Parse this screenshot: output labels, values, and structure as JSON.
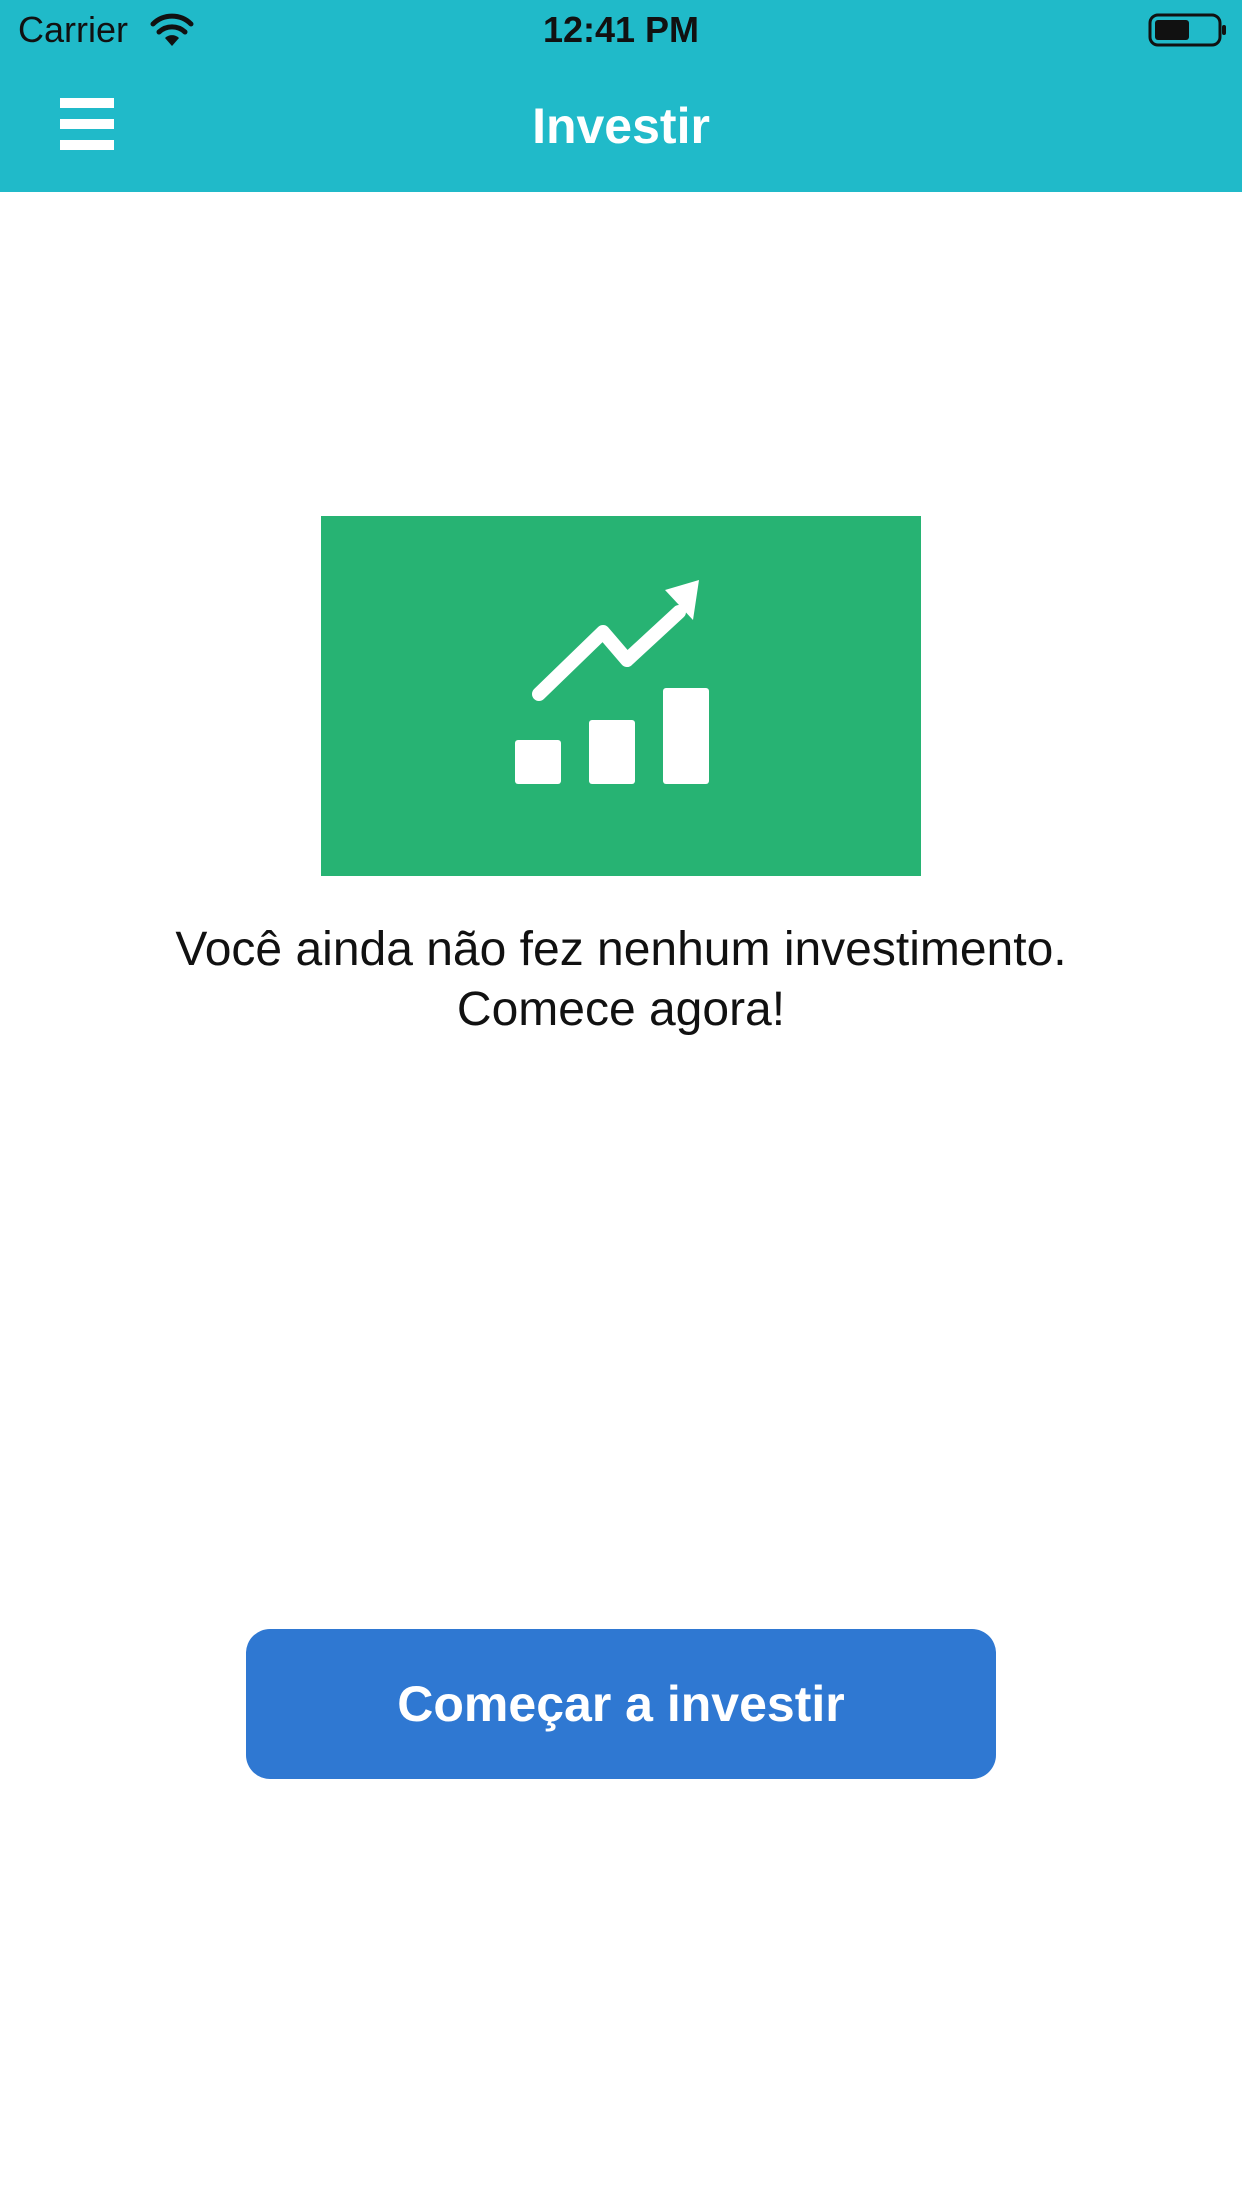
{
  "status_bar": {
    "carrier": "Carrier",
    "time": "12:41 PM",
    "wifi_icon": "wifi-icon",
    "battery_icon": "battery-icon"
  },
  "nav_bar": {
    "title": "Investir",
    "menu_icon": "hamburger-menu-icon"
  },
  "empty_state": {
    "illustration_icon": "growth-chart-icon",
    "message_line1": "Você ainda não fez nenhum investimento.",
    "message_line2": "Comece agora!"
  },
  "cta": {
    "label": "Começar a investir"
  },
  "colors": {
    "header": "#20BAC9",
    "illustration_bg": "#27B373",
    "button": "#2F78D2",
    "text": "#111111",
    "background": "#FFFFFF"
  }
}
